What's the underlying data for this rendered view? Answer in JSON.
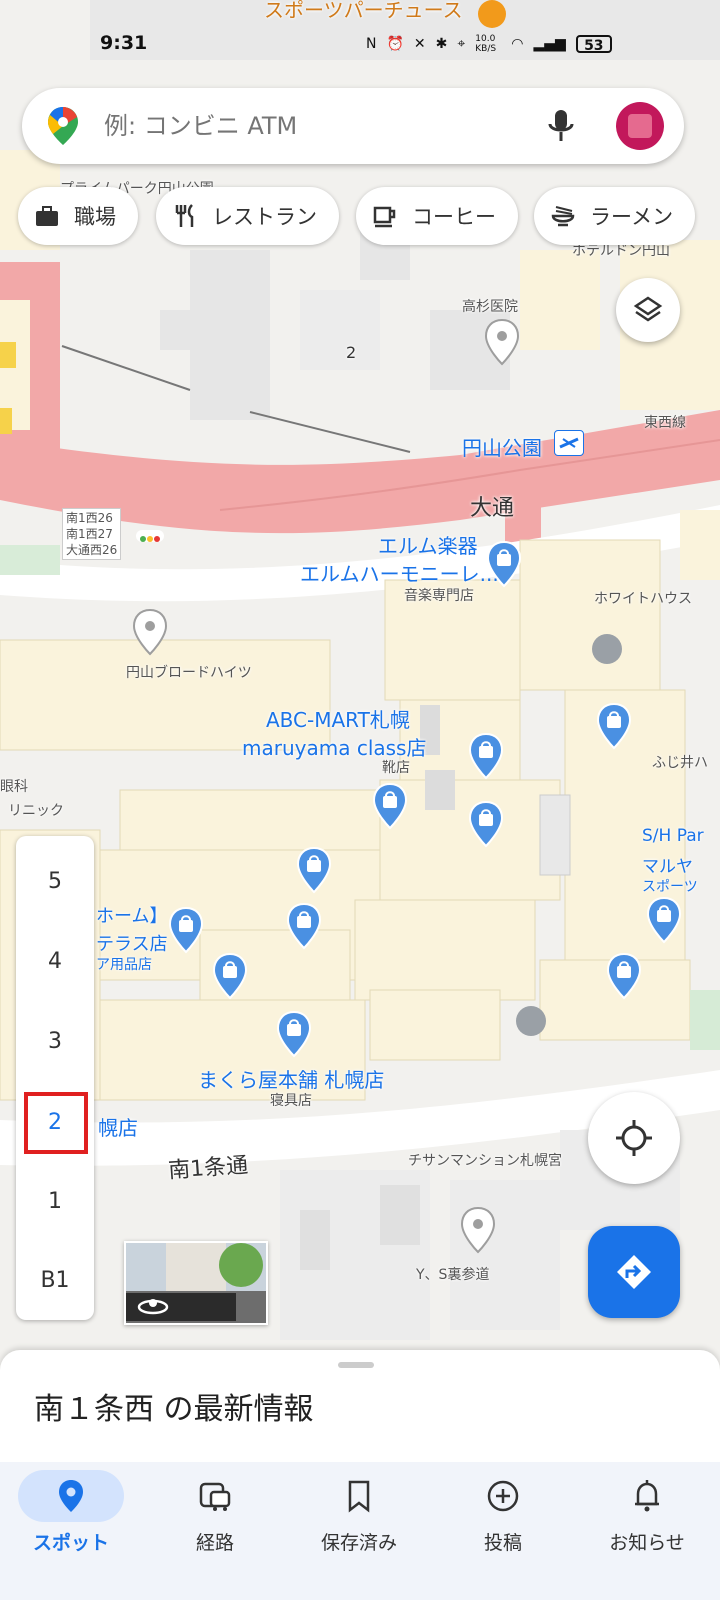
{
  "status": {
    "time": "9:31",
    "net_speed": "10.0 KB/S",
    "battery": "53"
  },
  "search": {
    "placeholder": "例: コンビニ ATM"
  },
  "chips": [
    {
      "label": "職場",
      "icon": "briefcase-icon"
    },
    {
      "label": "レストラン",
      "icon": "fork-knife-icon"
    },
    {
      "label": "コーヒー",
      "icon": "coffee-icon"
    },
    {
      "label": "ラーメン",
      "icon": "ramen-icon"
    }
  ],
  "map": {
    "labels": {
      "top_store": "スポーツパーチュース",
      "park": "プライムパーク円山公園",
      "hotel": "ホテルドン円山",
      "clinic": "高杉医院",
      "station": "円山公園",
      "line": "東西線",
      "odori": "大通",
      "signal": "南1西26\n南1西27\n大通西26",
      "elm_gakki": "エルム楽器",
      "elm_harmony": "エルムハーモニーレ...",
      "music_store": "音楽専門店",
      "white_house": "ホワイトハウス",
      "broad_heights": "円山ブロードハイツ",
      "abc_mart_1": "ABC-MART札幌",
      "abc_mart_2": "maruyama class店",
      "shoe_store": "靴店",
      "fujii": "ふじ井ハ",
      "ganka": "眼科",
      "clinic_left": "リニック",
      "sh_park_1": "S/H Par",
      "sh_park_2": "マルヤ",
      "sports": "スポーツ",
      "home_1": "ホーム】",
      "home_2": "テラス店",
      "interior": "ア用品店",
      "makuraya": "まくら屋本舗 札幌店",
      "bedding": "寝具店",
      "minami_1": "南1条通",
      "chisan": "チサンマンション札幌宮",
      "ys": "Y、S裏参道",
      "floor_num_map": "2",
      "left_store": "幌店"
    }
  },
  "floors": [
    "5",
    "4",
    "3",
    "2",
    "1",
    "B1"
  ],
  "active_floor": "2",
  "sheet": {
    "title": "南１条西 の最新情報"
  },
  "nav": [
    {
      "label": "スポット",
      "icon": "location-pin-icon",
      "active": true
    },
    {
      "label": "経路",
      "icon": "commute-icon",
      "active": false
    },
    {
      "label": "保存済み",
      "icon": "bookmark-icon",
      "active": false
    },
    {
      "label": "投稿",
      "icon": "add-circle-icon",
      "active": false
    },
    {
      "label": "お知らせ",
      "icon": "bell-icon",
      "active": false
    }
  ],
  "colors": {
    "accent": "#1a73e8",
    "road": "#f2a8a8",
    "building": "#faf3dc",
    "highlight": "#e02020"
  }
}
